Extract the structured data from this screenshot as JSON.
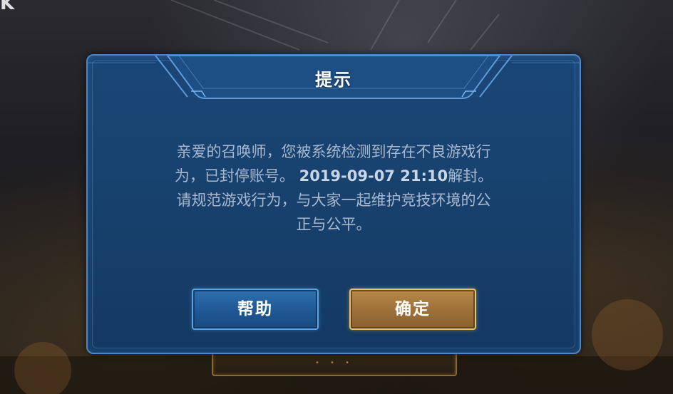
{
  "background": {
    "logo_text": "K"
  },
  "dialog": {
    "title": "提示",
    "message": {
      "line1": "亲爱的召唤师，您被系统检测到存在不良游戏行",
      "line2_prefix": "为，已封停账号。",
      "line2_date": "2019-09-07 21:10",
      "line2_suffix": "解封。",
      "line3": "请规范游戏行为，与大家一起维护竞技环境的公",
      "line4": "正与公平。"
    },
    "buttons": {
      "help_label": "帮助",
      "ok_label": "确定"
    }
  },
  "colors": {
    "dialog_bg": "#18426f",
    "dialog_border": "#4c86c6",
    "help_button": "#1f5794",
    "ok_button": "#9c7038",
    "message_text": "#a8b9cf"
  }
}
